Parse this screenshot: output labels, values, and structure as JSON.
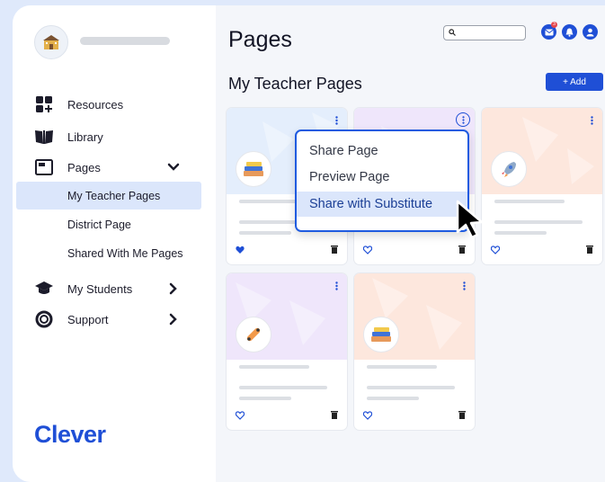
{
  "sidebar": {
    "nav": [
      {
        "label": "Resources",
        "icon": "grid-plus-icon"
      },
      {
        "label": "Library",
        "icon": "book-open-icon"
      },
      {
        "label": "Pages",
        "icon": "pages-window-icon"
      },
      {
        "label": "My Students",
        "icon": "graduation-cap-icon"
      },
      {
        "label": "Support",
        "icon": "lifebuoy-icon"
      }
    ],
    "pages_sub": [
      {
        "label": "My Teacher Pages",
        "active": true
      },
      {
        "label": "District Page",
        "active": false
      },
      {
        "label": "Shared With Me Pages",
        "active": false
      }
    ],
    "brand": "Clever"
  },
  "header": {
    "title": "Pages",
    "notification_count": "3"
  },
  "main": {
    "section_title": "My Teacher Pages",
    "add_label": "+ Add",
    "cards": [
      {
        "icon": "books-stack-icon",
        "favorite": true,
        "banner": "#e4eefc"
      },
      {
        "icon": "books-stack-icon",
        "favorite": false,
        "banner": "#efe6fb"
      },
      {
        "icon": "rocket-icon",
        "favorite": false,
        "banner": "#fde7dd"
      },
      {
        "icon": "skateboard-icon",
        "favorite": false,
        "banner": "#efe6fb"
      },
      {
        "icon": "books-stack-icon",
        "favorite": false,
        "banner": "#fde7dd"
      }
    ]
  },
  "context_menu": {
    "items": [
      {
        "label": "Share Page"
      },
      {
        "label": "Preview Page"
      },
      {
        "label": "Share with Substitute",
        "highlighted": true
      }
    ]
  },
  "colors": {
    "accent": "#1f4fd6",
    "active_bg": "#dbe6fb",
    "page_bg": "#f4f6fa"
  }
}
